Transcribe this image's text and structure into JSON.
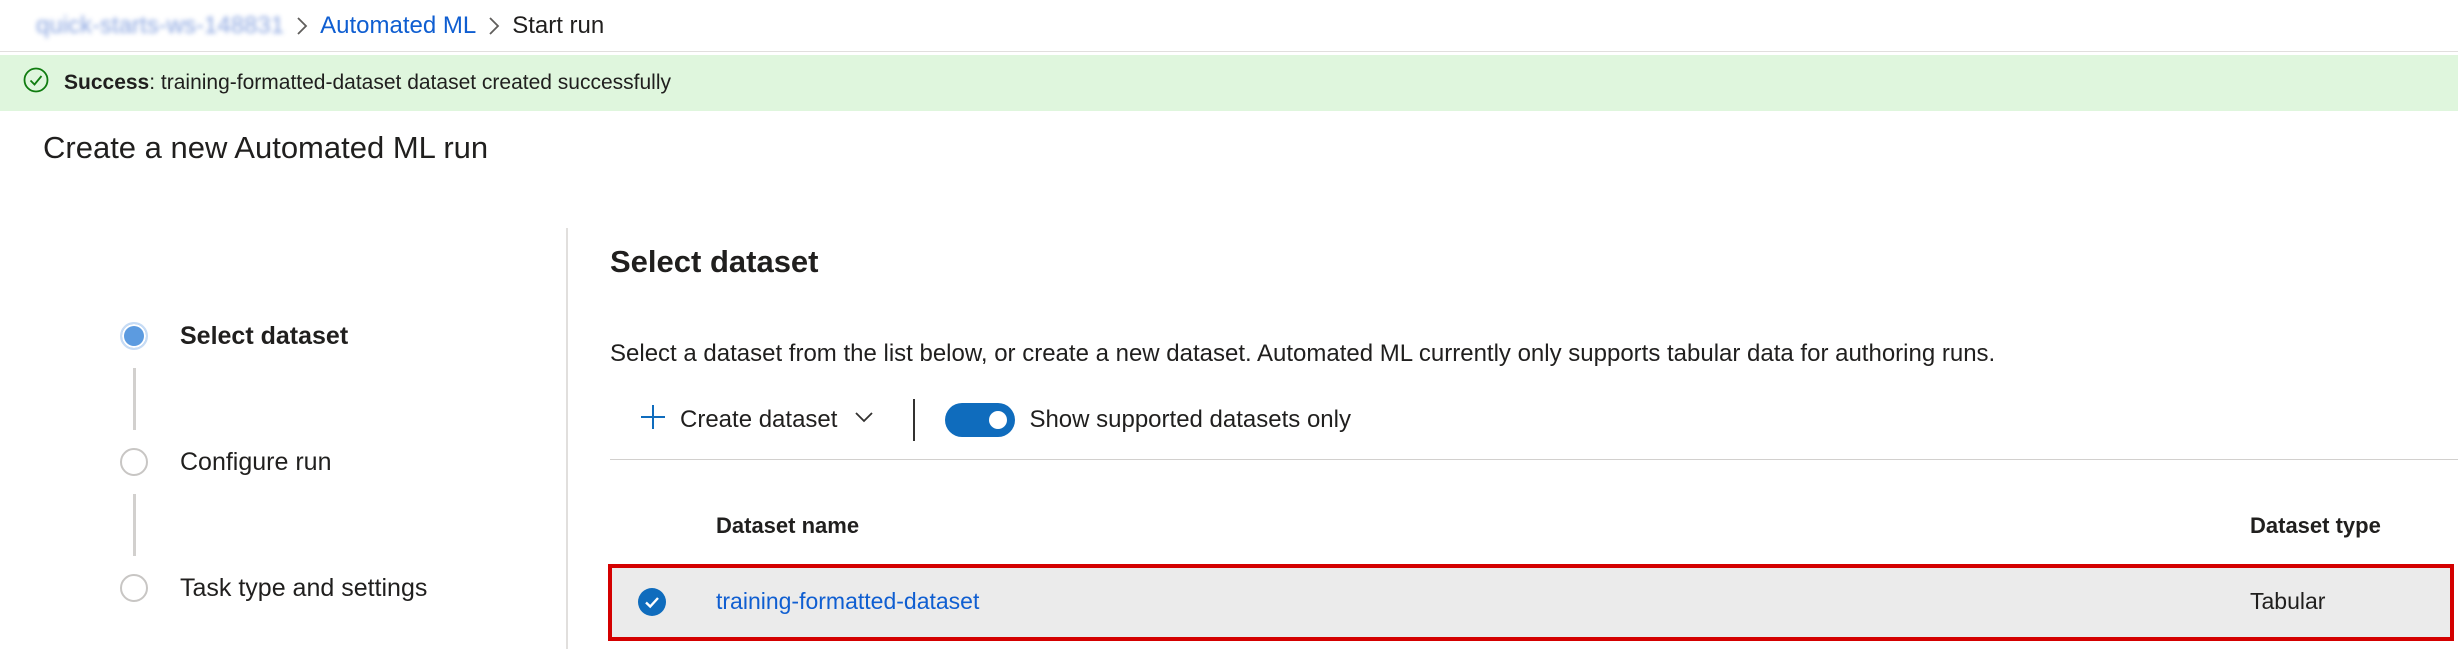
{
  "breadcrumb": {
    "workspace": "quick-starts-ws-148831",
    "automl": "Automated ML",
    "current": "Start run"
  },
  "notification": {
    "type": "Success",
    "title": "Success",
    "message": " : training-formatted-dataset dataset created successfully",
    "color": "#dff6dd",
    "icon": "check-circle-icon"
  },
  "page": {
    "title": "Create a new Automated ML run"
  },
  "steps": [
    {
      "label": "Select dataset",
      "state": "active"
    },
    {
      "label": "Configure run",
      "state": "pending"
    },
    {
      "label": "Task type and settings",
      "state": "pending"
    }
  ],
  "main": {
    "section_title": "Select dataset",
    "description": "Select a dataset from the list below, or create a new dataset. Automated ML currently only supports tabular data for authoring runs.",
    "toolbar": {
      "create_label": "Create dataset",
      "toggle_label": "Show supported datasets only",
      "toggle_on": true,
      "accent": "#0f6cbd"
    },
    "table": {
      "columns": [
        "Dataset name",
        "Dataset type"
      ],
      "rows": [
        {
          "name": "training-formatted-dataset",
          "type": "Tabular",
          "selected": true
        }
      ]
    }
  }
}
